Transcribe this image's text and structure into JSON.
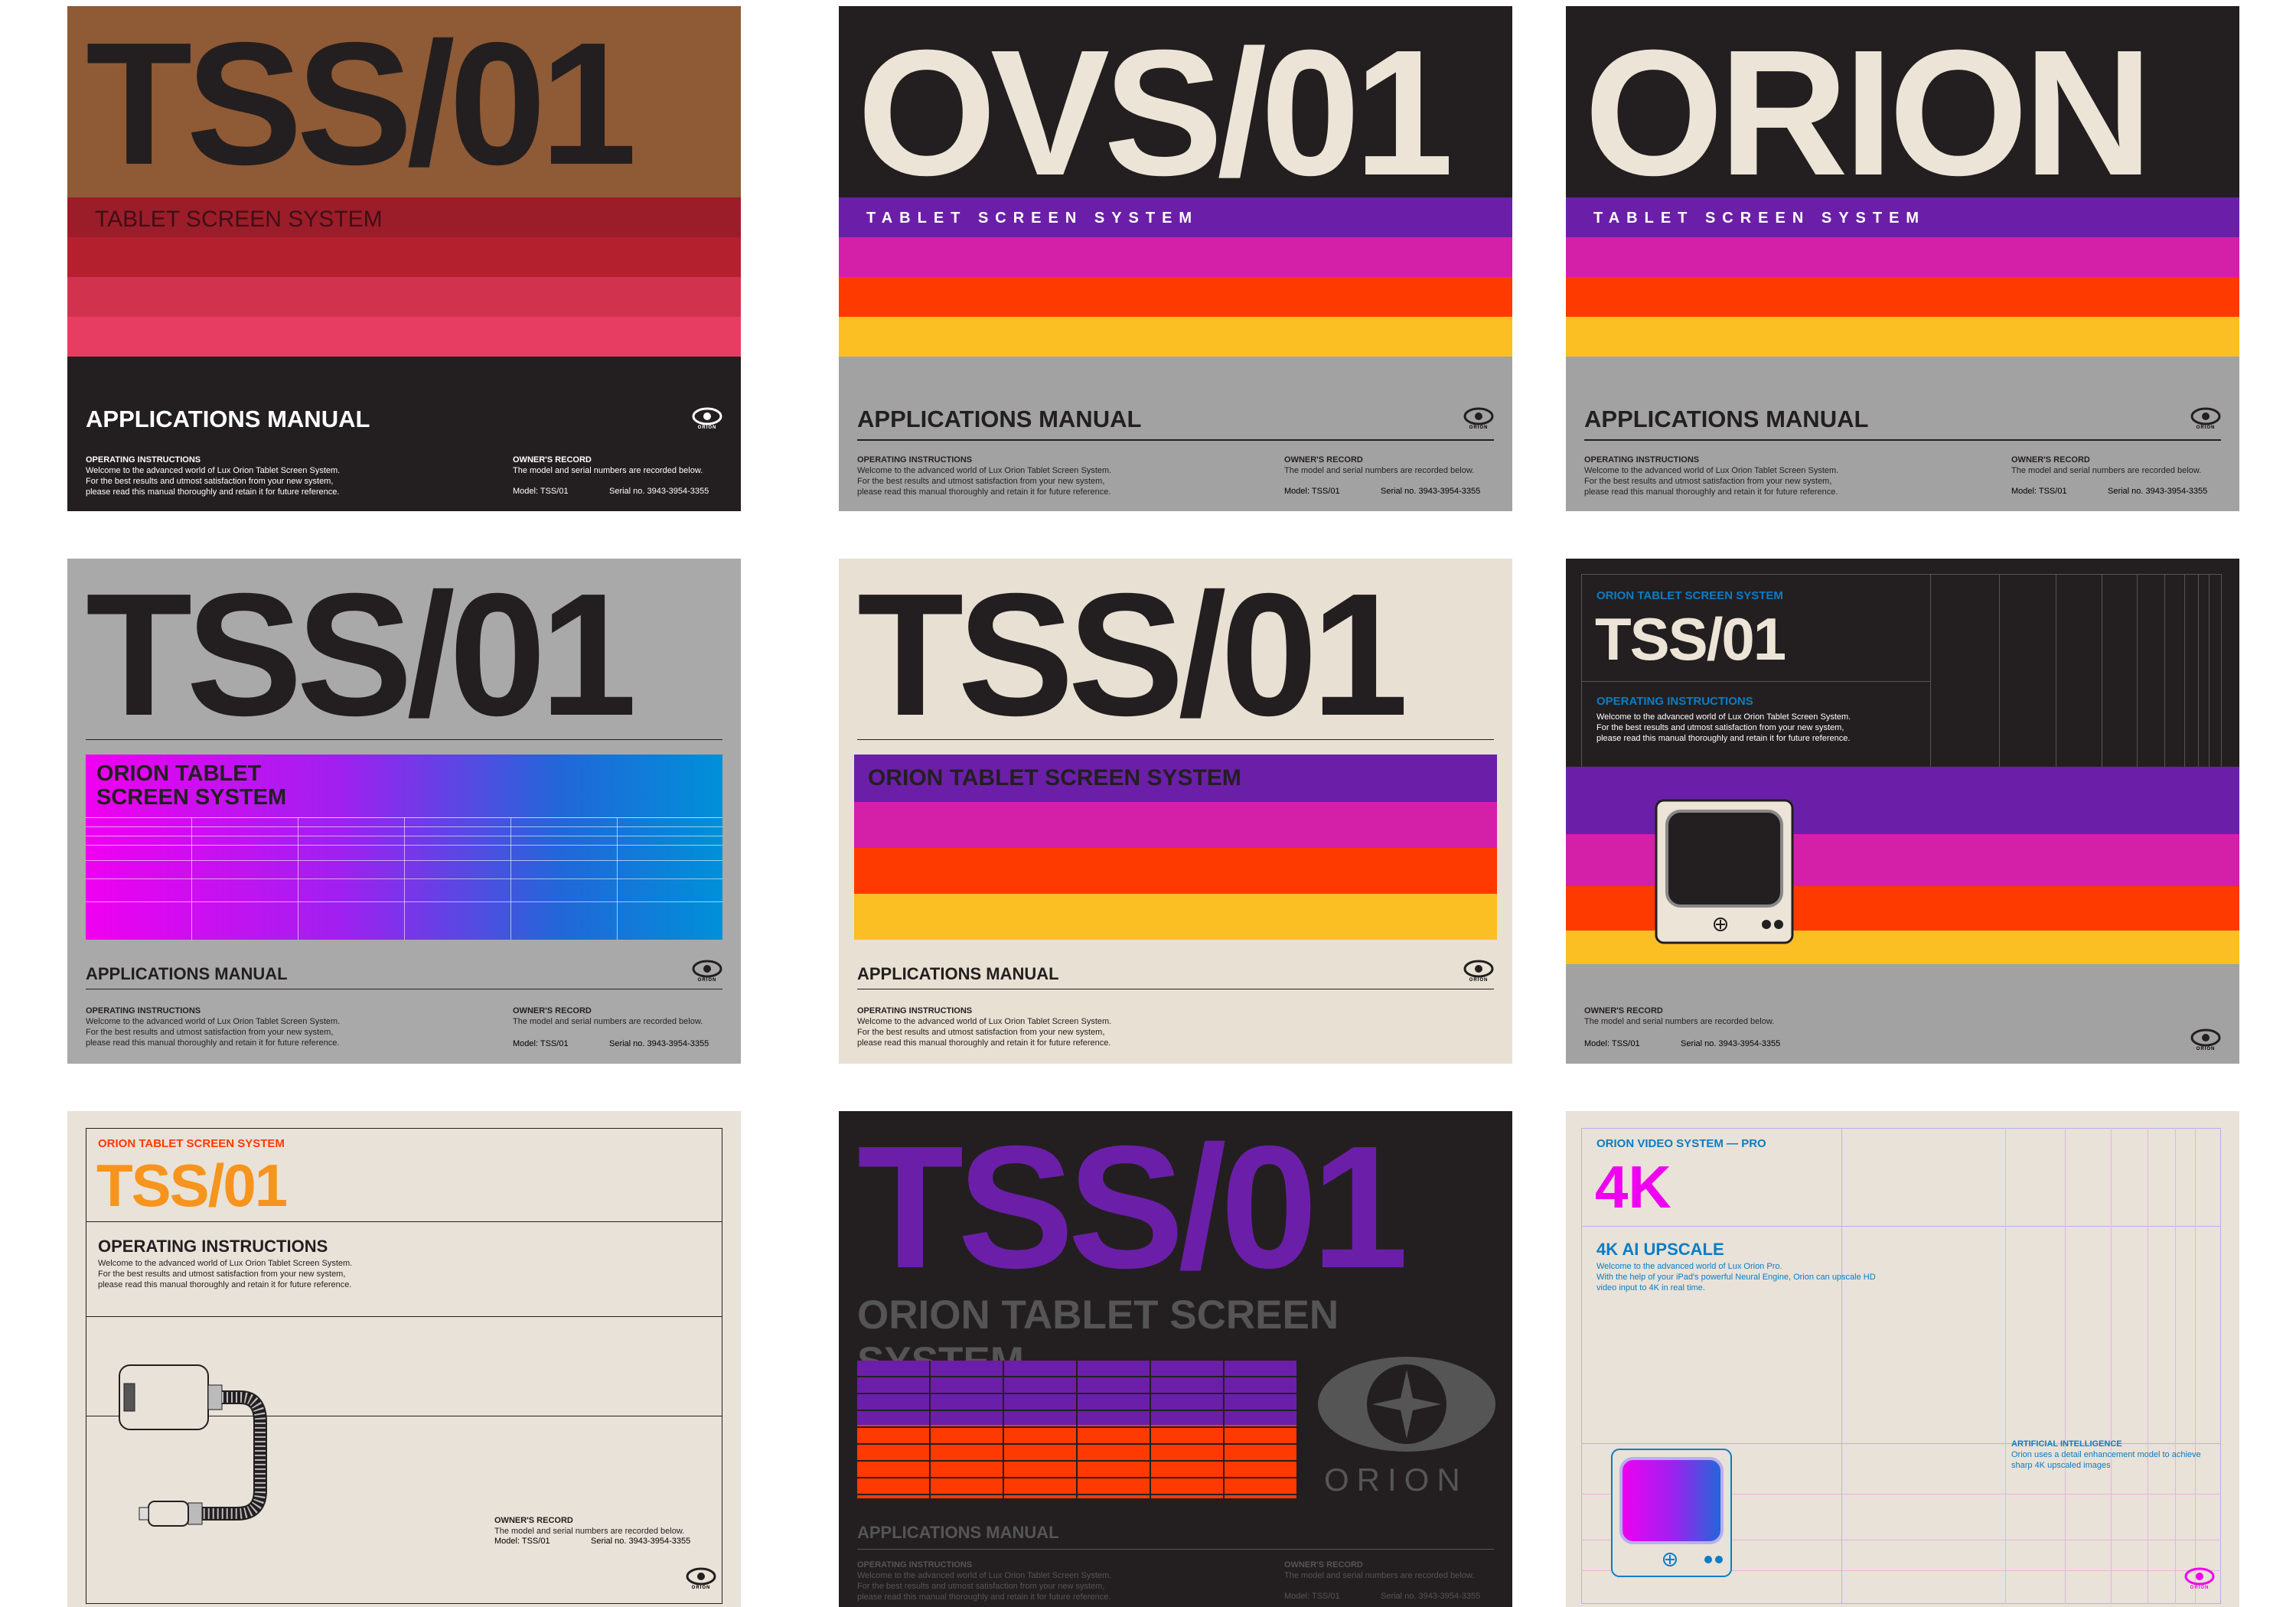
{
  "common": {
    "subtitle_a": "TABLET SCREEN SYSTEM",
    "applications_manual": "APPLICATIONS MANUAL",
    "operating_instructions": "OPERATING INSTRUCTIONS",
    "op_line1": "Welcome to the advanced world of Lux Orion Tablet Screen System.",
    "op_line2": "For the best results and utmost satisfaction from your new system,",
    "op_line3": "please read this manual thoroughly and retain it for future reference.",
    "owners_record": "OWNER'S RECORD",
    "owners_line": "The model and serial numbers are recorded below.",
    "model": "Model: TSS/01",
    "serial": "Serial no. 3943-3954-3355",
    "logo_text": "ORION",
    "orion_tss": "ORION TABLET SCREEN SYSTEM"
  },
  "cards": {
    "c1": {
      "big": "TSS/01",
      "subtitle": "TABLET SCREEN SYSTEM"
    },
    "c2": {
      "big": "OVS/01",
      "subtitle": "TABLET SCREEN SYSTEM"
    },
    "c3": {
      "big": "ORION",
      "subtitle": "TABLET SCREEN SYSTEM"
    },
    "c4": {
      "big": "TSS/01",
      "sub1": "ORION TABLET",
      "sub2": "SCREEN SYSTEM"
    },
    "c5": {
      "big": "TSS/01",
      "subtitle": "ORION TABLET SCREEN SYSTEM"
    },
    "c6": {
      "kicker": "ORION TABLET SCREEN SYSTEM",
      "big": "TSS/01",
      "heading": "OPERATING INSTRUCTIONS"
    },
    "c7": {
      "kicker": "ORION TABLET SCREEN SYSTEM",
      "big": "TSS/01",
      "heading": "OPERATING INSTRUCTIONS"
    },
    "c8": {
      "big": "TSS/01",
      "subtitle": "ORION TABLET SCREEN SYSTEM",
      "logo_large": "ORION"
    },
    "c9": {
      "kicker": "ORION VIDEO SYSTEM — PRO",
      "big": "4K",
      "heading": "4K AI UPSCALE",
      "line1": "Welcome to the advanced world of Lux Orion Pro.",
      "line2": "With the help of your iPad's powerful Neural Engine, Orion can upscale HD",
      "line3": "video input to 4K in real time.",
      "ai_heading": "ARTIFICIAL INTELLIGENCE",
      "ai_line1": "Orion uses a detail enhancement model to achieve",
      "ai_line2": "sharp 4K upscaled images"
    }
  },
  "colors": {
    "dark": "#231f20",
    "cream": "#e8e2d8",
    "grey": "#a2a2a3",
    "purple": "#6b1fa8",
    "magenta": "#d41fa8",
    "orange": "#ff3a00",
    "yellow": "#fbbf24",
    "brown": "#8f5a36",
    "blue": "#0a7dc6"
  }
}
